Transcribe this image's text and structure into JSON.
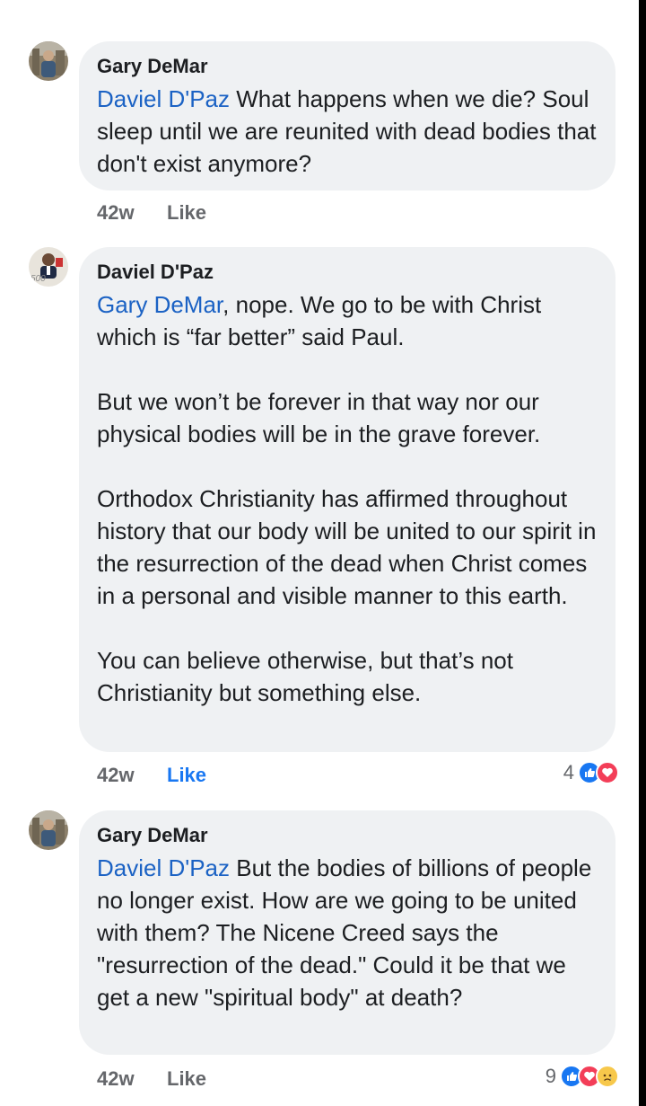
{
  "comments": [
    {
      "author": "Gary DeMar",
      "mention": "Daviel D'Paz",
      "paragraphs": [
        " What happens when we die? Soul sleep until we are reunited with dead bodies that don't exist anymore?"
      ],
      "time": "42w",
      "like_label": "Like",
      "reaction_count": "",
      "reactions": []
    },
    {
      "author": "Daviel D'Paz",
      "mention": "Gary DeMar",
      "paragraphs": [
        ", nope. We go to be with Christ which is “far better” said Paul.",
        "But we won’t be forever in that way nor our physical bodies will be in the grave forever.",
        "Orthodox Christianity has affirmed throughout history that our body will be united to our spirit in the resurrection of the dead when Christ comes in a personal and visible manner to this earth.",
        "You can believe otherwise, but that’s not Christianity but something else."
      ],
      "time": "42w",
      "like_label": "Like",
      "reaction_count": "4",
      "reactions": [
        "like-icon",
        "love-icon"
      ]
    },
    {
      "author": "Gary DeMar",
      "mention": "Daviel D'Paz",
      "paragraphs": [
        " But the bodies of billions of people no longer exist. How are we going to be united with them? The Nicene Creed says the \"resurrection of the dead.\" Could it be that we get a new \"spiritual body\" at death?"
      ],
      "time": "42w",
      "like_label": "Like",
      "reaction_count": "9",
      "reactions": [
        "like-icon",
        "love-icon",
        "sad-icon"
      ]
    }
  ],
  "colors": {
    "mention": "#1b62c4",
    "like_active": "#1877f2",
    "bubble": "#eff1f3",
    "love": "#f33e58"
  },
  "avatar_badge": "500"
}
